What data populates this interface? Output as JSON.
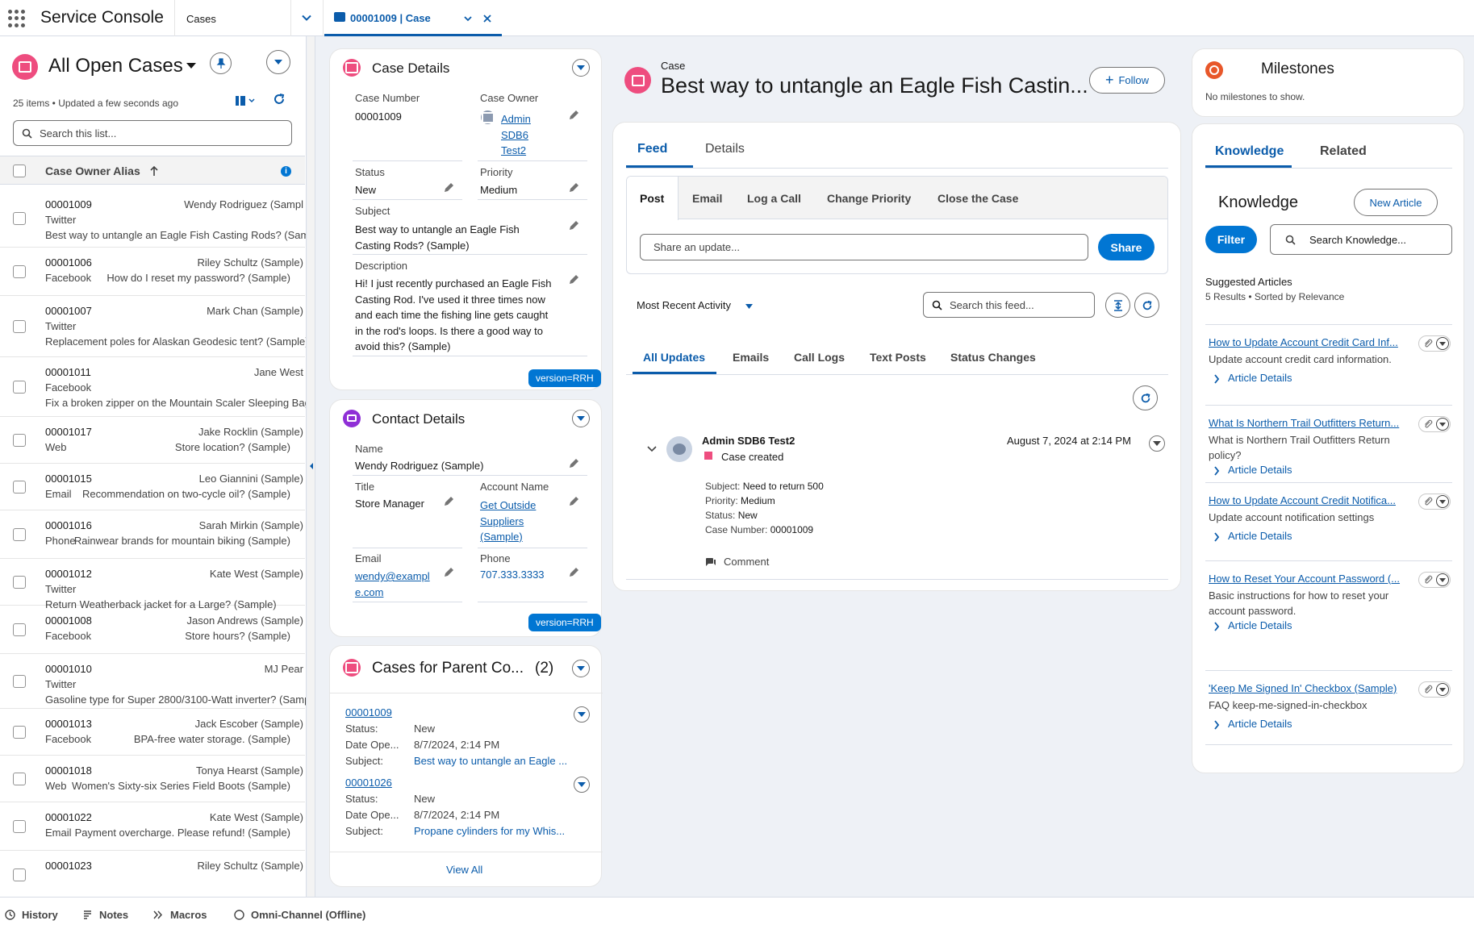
{
  "header": {
    "app_name": "Service Console",
    "nav_selector": "Cases",
    "tab_label": "00001009 | Case"
  },
  "list": {
    "title": "All Open Cases",
    "meta": "25 items • Updated a few seconds ago",
    "search_placeholder": "Search this list...",
    "column_header": "Case Owner Alias",
    "rows": [
      {
        "number": "00001009",
        "owner": "Wendy Rodriguez (Sampl",
        "channel": "Twitter",
        "subject": "Best way to untangle an Eagle Fish Casting Rods? (Sampl"
      },
      {
        "number": "00001006",
        "owner": "Riley Schultz (Sample)",
        "channel": "Facebook",
        "subject": "How do I reset my password? (Sample)"
      },
      {
        "number": "00001007",
        "owner": "Mark Chan (Sample)",
        "channel": "Twitter",
        "subject": "Replacement poles for Alaskan Geodesic tent? (Sample)"
      },
      {
        "number": "00001011",
        "owner": "Jane West",
        "channel": "Facebook",
        "subject": "Fix a broken zipper on the Mountain Scaler Sleeping Bag?"
      },
      {
        "number": "00001017",
        "owner": "Jake Rocklin (Sample)",
        "channel": "Web",
        "subject": "Store location? (Sample)"
      },
      {
        "number": "00001015",
        "owner": "Leo Giannini (Sample)",
        "channel": "Email",
        "subject": "Recommendation on two-cycle oil? (Sample)"
      },
      {
        "number": "00001016",
        "owner": "Sarah Mirkin (Sample)",
        "channel": "Phone",
        "subject": "Rainwear brands for mountain biking (Sample)"
      },
      {
        "number": "00001012",
        "owner": "Kate West (Sample)",
        "channel": "Twitter",
        "subject": "Return Weatherback jacket for a Large? (Sample)"
      },
      {
        "number": "00001008",
        "owner": "Jason Andrews (Sample)",
        "channel": "Facebook",
        "subject": "Store hours? (Sample)"
      },
      {
        "number": "00001010",
        "owner": "MJ Pear",
        "channel": "Twitter",
        "subject": "Gasoline type for Super 2800/3100-Watt inverter? (Samp"
      },
      {
        "number": "00001013",
        "owner": "Jack Escober (Sample)",
        "channel": "Facebook",
        "subject": "BPA-free water storage. (Sample)"
      },
      {
        "number": "00001018",
        "owner": "Tonya Hearst (Sample)",
        "channel": "Web",
        "subject": "Women's Sixty-six Series Field Boots (Sample)"
      },
      {
        "number": "00001022",
        "owner": "Kate West (Sample)",
        "channel": "Email",
        "subject": "Payment overcharge. Please refund! (Sample)"
      },
      {
        "number": "00001023",
        "owner": "Riley Schultz (Sample)",
        "channel": "",
        "subject": ""
      }
    ]
  },
  "case_details": {
    "title": "Case Details",
    "case_number_label": "Case Number",
    "case_number": "00001009",
    "case_owner_label": "Case Owner",
    "case_owner_lines": [
      "Admin",
      "SDB6",
      "Test2"
    ],
    "status_label": "Status",
    "status": "New",
    "priority_label": "Priority",
    "priority": "Medium",
    "subject_label": "Subject",
    "subject_lines": [
      "Best way to untangle an Eagle Fish",
      "Casting Rods? (Sample)"
    ],
    "description_label": "Description",
    "description_lines": [
      "Hi! I just recently purchased an Eagle Fish",
      "Casting Rod. I've used it three times now",
      "and each time the fishing line gets caught",
      "in the rod's loops. Is there a good way to",
      "avoid this? (Sample)"
    ],
    "version_badge": "version=RRH"
  },
  "contact_details": {
    "title": "Contact Details",
    "name_label": "Name",
    "name": "Wendy Rodriguez (Sample)",
    "title_label": "Title",
    "title_value": "Store Manager",
    "account_label": "Account Name",
    "account_lines": [
      "Get Outside",
      "Suppliers",
      "(Sample)"
    ],
    "email_label": "Email",
    "email_lines": [
      "wendy@exampl",
      "e.com"
    ],
    "phone_label": "Phone",
    "phone": "707.333.3333",
    "version_badge": "version=RRH"
  },
  "parent_cases": {
    "title": "Cases for Parent Co...",
    "count": "(2)",
    "status_label": "Status:",
    "date_label": "Date Ope...",
    "subject_label": "Subject:",
    "items": [
      {
        "number": "00001009",
        "status": "New",
        "date": "8/7/2024, 2:14 PM",
        "subject": "Best way to untangle an Eagle ..."
      },
      {
        "number": "00001026",
        "status": "New",
        "date": "8/7/2024, 2:14 PM",
        "subject": "Propane cylinders for my Whis..."
      }
    ],
    "view_all": "View All"
  },
  "case_header": {
    "object_label": "Case",
    "title": "Best way to untangle an Eagle Fish Castin...",
    "follow": "Follow"
  },
  "feed": {
    "tabs": [
      "Feed",
      "Details"
    ],
    "publisher_tabs": [
      "Post",
      "Email",
      "Log a Call",
      "Change Priority",
      "Close the Case"
    ],
    "share_placeholder": "Share an update...",
    "share_button": "Share",
    "sort_label": "Most Recent Activity",
    "search_placeholder": "Search this feed...",
    "filter_tabs": [
      "All Updates",
      "Emails",
      "Call Logs",
      "Text Posts",
      "Status Changes"
    ],
    "item": {
      "author": "Admin SDB6 Test2",
      "action": "Case created",
      "timestamp": "August 7, 2024 at 2:14 PM",
      "subject_label": "Subject:",
      "subject": "Need to return 500",
      "priority_label": "Priority:",
      "priority": "Medium",
      "status_label": "Status:",
      "status": "New",
      "case_number_label": "Case Number:",
      "case_number": "00001009",
      "comment": "Comment"
    }
  },
  "milestones": {
    "title": "Milestones",
    "empty": "No milestones to show."
  },
  "knowledge": {
    "tabs": [
      "Knowledge",
      "Related"
    ],
    "heading": "Knowledge",
    "new_article": "New Article",
    "filter": "Filter",
    "search_placeholder": "Search Knowledge...",
    "suggested_title": "Suggested Articles",
    "suggested_meta": "5 Results • Sorted by Relevance",
    "details_label": "Article Details",
    "articles": [
      {
        "title": "How to Update Account Credit Card Inf...",
        "desc_lines": [
          "Update account credit card information."
        ]
      },
      {
        "title": "What Is Northern Trail Outfitters Return...",
        "desc_lines": [
          "What is Northern Trail Outfitters Return",
          "policy?"
        ]
      },
      {
        "title": "How to Update Account Credit Notifica...",
        "desc_lines": [
          "Update account notification settings"
        ]
      },
      {
        "title": "How to Reset Your Account Password (...",
        "desc_lines": [
          "Basic instructions for how to reset your",
          "account password."
        ]
      },
      {
        "title": "'Keep Me Signed In' Checkbox (Sample)",
        "desc_lines": [
          "FAQ keep-me-signed-in-checkbox"
        ]
      }
    ]
  },
  "footer": {
    "items": [
      "History",
      "Notes",
      "Macros",
      "Omni-Channel (Offline)"
    ]
  },
  "colors": {
    "brand": "#0176d3",
    "link": "#0b5cab",
    "case_icon": "#ee4d7f",
    "contact_icon": "#8f2fd6",
    "milestone_icon": "#e8572a"
  }
}
